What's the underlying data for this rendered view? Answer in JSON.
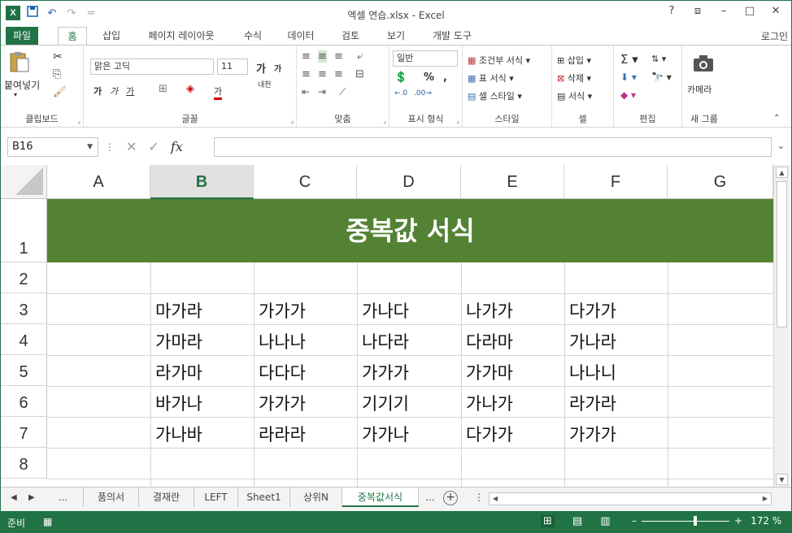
{
  "window": {
    "title": "엑셀 연습.xlsx - Excel",
    "help": "?",
    "restore_ribbon": "⧈",
    "minimize": "–",
    "maximize": "□",
    "close": "✕",
    "signin": "로그인"
  },
  "qat": {
    "save_icon": "💾",
    "undo": "↶",
    "redo": "↷",
    "customize": "="
  },
  "tabs": [
    {
      "label": "파일"
    },
    {
      "label": "홈"
    },
    {
      "label": "삽입"
    },
    {
      "label": "페이지 레이아웃"
    },
    {
      "label": "수식"
    },
    {
      "label": "데이터"
    },
    {
      "label": "검토"
    },
    {
      "label": "보기"
    },
    {
      "label": "개발 도구"
    }
  ],
  "ribbon": {
    "clipboard": {
      "label": "클립보드",
      "paste": "붙여넣기"
    },
    "font": {
      "label": "글꼴",
      "name": "맑은 고딕",
      "size": "11",
      "grow": "가",
      "shrink": "가",
      "bold": "가",
      "italic": "가",
      "underline": "가",
      "fontcolor": "가",
      "phonetic": "내천"
    },
    "alignment": {
      "label": "맞춤"
    },
    "number": {
      "label": "표시 형식",
      "format": "일반",
      "percent": "%",
      "comma": ","
    },
    "styles": {
      "label": "스타일",
      "conditional": "조건부 서식",
      "table": "표 서식",
      "cell": "셀 스타일"
    },
    "cells": {
      "label": "셀",
      "insert": "삽입",
      "delete": "삭제",
      "format": "서식"
    },
    "editing": {
      "label": "편집"
    },
    "newgroup": {
      "label": "새 그룹",
      "camera": "카메라"
    }
  },
  "formula_bar": {
    "name_box": "B16",
    "fx": "fx",
    "value": ""
  },
  "grid": {
    "columns": [
      "A",
      "B",
      "C",
      "D",
      "E",
      "F",
      "G"
    ],
    "selected_column": "B",
    "rows": [
      "1",
      "2",
      "3",
      "4",
      "5",
      "6",
      "7",
      "8"
    ],
    "banner": "중복값 서식",
    "data": [
      [
        "마가라",
        "가가가",
        "가나다",
        "나가가",
        "다가가"
      ],
      [
        "가마라",
        "나나나",
        "나다라",
        "다라마",
        "가나라"
      ],
      [
        "라가마",
        "다다다",
        "가가가",
        "가가마",
        "나나니"
      ],
      [
        "바가나",
        "가가가",
        "기기기",
        "가나가",
        "라가라"
      ],
      [
        "가나바",
        "라라라",
        "가가나",
        "다가가",
        "가가가"
      ]
    ]
  },
  "sheets": {
    "ellipsis_left": "...",
    "tabs": [
      {
        "label": "품의서"
      },
      {
        "label": "결재란"
      },
      {
        "label": "LEFT"
      },
      {
        "label": "Sheet1"
      },
      {
        "label": "상위N"
      },
      {
        "label": "중복값서식"
      }
    ],
    "active": "중복값서식",
    "ellipsis_right": "...",
    "add": "+"
  },
  "status": {
    "ready": "준비",
    "zoom": "172 %"
  },
  "colors": {
    "excel_green": "#217346",
    "banner_green": "#548235"
  }
}
